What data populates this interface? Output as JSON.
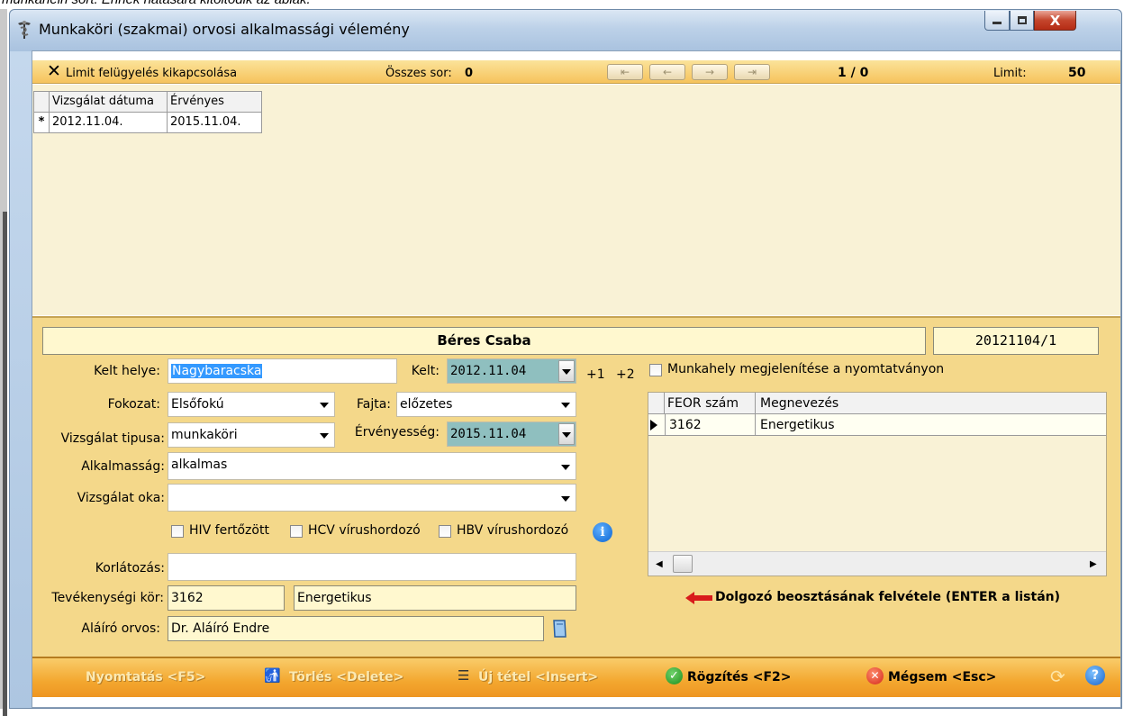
{
  "caption": "munkahelri sort. Ennek hatására kitöltődik az ablak.",
  "window": {
    "title": "Munkaköri (szakmai) orvosi alkalmassági vélemény",
    "minimize_glyph": "–",
    "maximize_glyph": "□",
    "close_glyph": "X"
  },
  "toolbar": {
    "limit_toggle": "Limit felügyelés kikapcsolása",
    "total_rows_label": "Összes sor:",
    "total_rows_value": "0",
    "position": "1 / 0",
    "limit_label": "Limit:",
    "limit_value": "50",
    "nav_glyphs": [
      "⇤",
      "←",
      "→",
      "⇥"
    ]
  },
  "history_grid": {
    "columns": [
      "Vizsgálat dátuma",
      "Érvényes"
    ],
    "rows": [
      {
        "marker": "*",
        "cells": [
          "2012.11.04.",
          "2015.11.04."
        ]
      }
    ]
  },
  "header": {
    "patient_name": "Béres Csaba",
    "record_id": "20121104/1"
  },
  "form": {
    "kelt_helye": {
      "label": "Kelt helye:",
      "value": "Nagybaracska"
    },
    "kelt": {
      "label": "Kelt:",
      "value": "2012.11.04"
    },
    "plus1": "+1",
    "plus2": "+2",
    "fokozat": {
      "label": "Fokozat:",
      "value": "Elsőfokú"
    },
    "fajta": {
      "label": "Fajta:",
      "value": "előzetes"
    },
    "vizsgalat_tipusa": {
      "label": "Vizsgálat tipusa:",
      "value": "munkaköri"
    },
    "ervenyesseg": {
      "label": "Érvényesség:",
      "value": "2015.11.04"
    },
    "alkalmassag": {
      "label": "Alkalmasság:",
      "value": "alkalmas"
    },
    "vizsgalat_oka": {
      "label": "Vizsgálat oka:",
      "value": ""
    },
    "hiv": "HIV fertőzött",
    "hcv": "HCV vírushordozó",
    "hbv": "HBV vírushordozó",
    "korlatozas": {
      "label": "Korlátozás:",
      "value": ""
    },
    "tevekenysegi_kor": {
      "label": "Tevékenységi kör:",
      "code": "3162",
      "name": "Energetikus"
    },
    "alairo_orvos": {
      "label": "Aláíró orvos:",
      "value": "Dr. Aláíró Endre"
    }
  },
  "right_panel": {
    "workplace_checkbox": "Munkahely megjelenítése a nyomtatványon",
    "feor_columns": [
      "FEOR szám",
      "Megnevezés"
    ],
    "feor_rows": [
      [
        "3162",
        "Energetikus"
      ]
    ],
    "add_assignment_hint": "Dolgozó beosztásának felvétele (ENTER a listán)"
  },
  "bottom_bar": {
    "print": "Nyomtatás <F5>",
    "delete": "Törlés <Delete>",
    "new_item": "Új tétel <Insert>",
    "save": "Rögzítés <F2>",
    "cancel": "Mégsem <Esc>"
  },
  "colors": {
    "toolbar": "#f6c35c",
    "form_bg": "#f4d88a",
    "grid_bg": "#f9f2d6",
    "selected_text_bg": "#3399ff",
    "date_bg": "#8fbfbf",
    "bottom_bar": "#f3a72f"
  }
}
